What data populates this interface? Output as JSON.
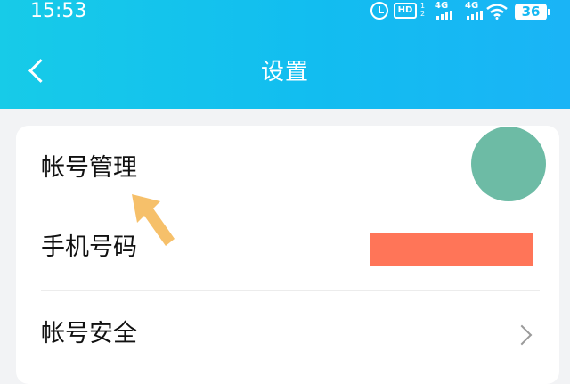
{
  "status_bar": {
    "time": "15:53",
    "hd_label": "HD",
    "hd_sub": "1\n2",
    "signal1_label": "4G",
    "signal2_label": "4G",
    "battery": "36"
  },
  "header": {
    "title": "设置",
    "back_icon": "chevron-left-icon"
  },
  "settings": {
    "items": [
      {
        "label": "帐号管理",
        "value": "avatar"
      },
      {
        "label": "手机号码",
        "value": "redacted"
      },
      {
        "label": "帐号安全",
        "value": "chevron-right-icon"
      }
    ]
  },
  "colors": {
    "header_start": "#17cbe8",
    "header_end": "#1ab4f6",
    "avatar": "#6dbba5",
    "redaction": "#ff7558",
    "pointer_arrow": "#f6c06a"
  }
}
